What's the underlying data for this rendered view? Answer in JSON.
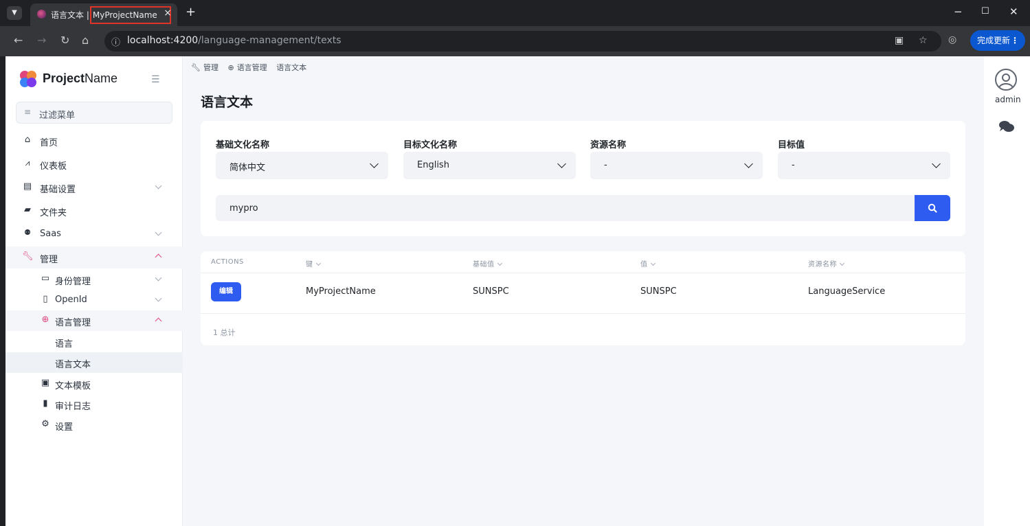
{
  "browser": {
    "tab_title_prefix": "语言文本 |",
    "tab_title_highlight": "MyProjectName",
    "tab_close": "×",
    "new_tab": "+",
    "url_host": "localhost:4200",
    "url_path": "/language-management/texts",
    "update_label": "完成更新",
    "update_menu": "⋮"
  },
  "sidebar": {
    "brand_bold": "Project",
    "brand_regular": "Name",
    "filter_placeholder": "过滤菜单",
    "items": [
      {
        "label": "首页",
        "icon": "home-icon"
      },
      {
        "label": "仪表板",
        "icon": "chart-line-icon"
      },
      {
        "label": "基础设置",
        "icon": "book-icon"
      },
      {
        "label": "文件夹",
        "icon": "folder-icon"
      },
      {
        "label": "Saas",
        "icon": "users-icon"
      },
      {
        "label": "管理",
        "icon": "wrench-icon"
      },
      {
        "label": "身份管理",
        "icon": "id-card-icon"
      },
      {
        "label": "OpenId",
        "icon": "id-badge-icon"
      },
      {
        "label": "语言管理",
        "icon": "globe-icon"
      },
      {
        "label": "语言"
      },
      {
        "label": "语言文本"
      },
      {
        "label": "文本模板",
        "icon": "inbox-icon"
      },
      {
        "label": "审计日志",
        "icon": "file-icon"
      },
      {
        "label": "设置",
        "icon": "gear-icon"
      }
    ]
  },
  "breadcrumb": {
    "items": [
      "管理",
      "语言管理",
      "语言文本"
    ]
  },
  "page": {
    "title": "语言文本"
  },
  "filters": {
    "base_culture_label": "基础文化名称",
    "base_culture_value": "简体中文",
    "target_culture_label": "目标文化名称",
    "target_culture_value": "English",
    "resource_label": "资源名称",
    "resource_value": "-",
    "target_value_label": "目标值",
    "target_value_value": "-",
    "search_value": "mypro"
  },
  "table": {
    "headers": [
      "ACTIONS",
      "键",
      "基础值",
      "值",
      "资源名称"
    ],
    "rows": [
      {
        "action": "编辑",
        "key": "MyProjectName",
        "base_value": "SUNSPC",
        "value": "SUNSPC",
        "resource": "LanguageService"
      }
    ],
    "total": "1 总计"
  },
  "user": {
    "name": "admin"
  },
  "colors": {
    "accent": "#2f5cf0",
    "active_menu": "#e0467c"
  }
}
